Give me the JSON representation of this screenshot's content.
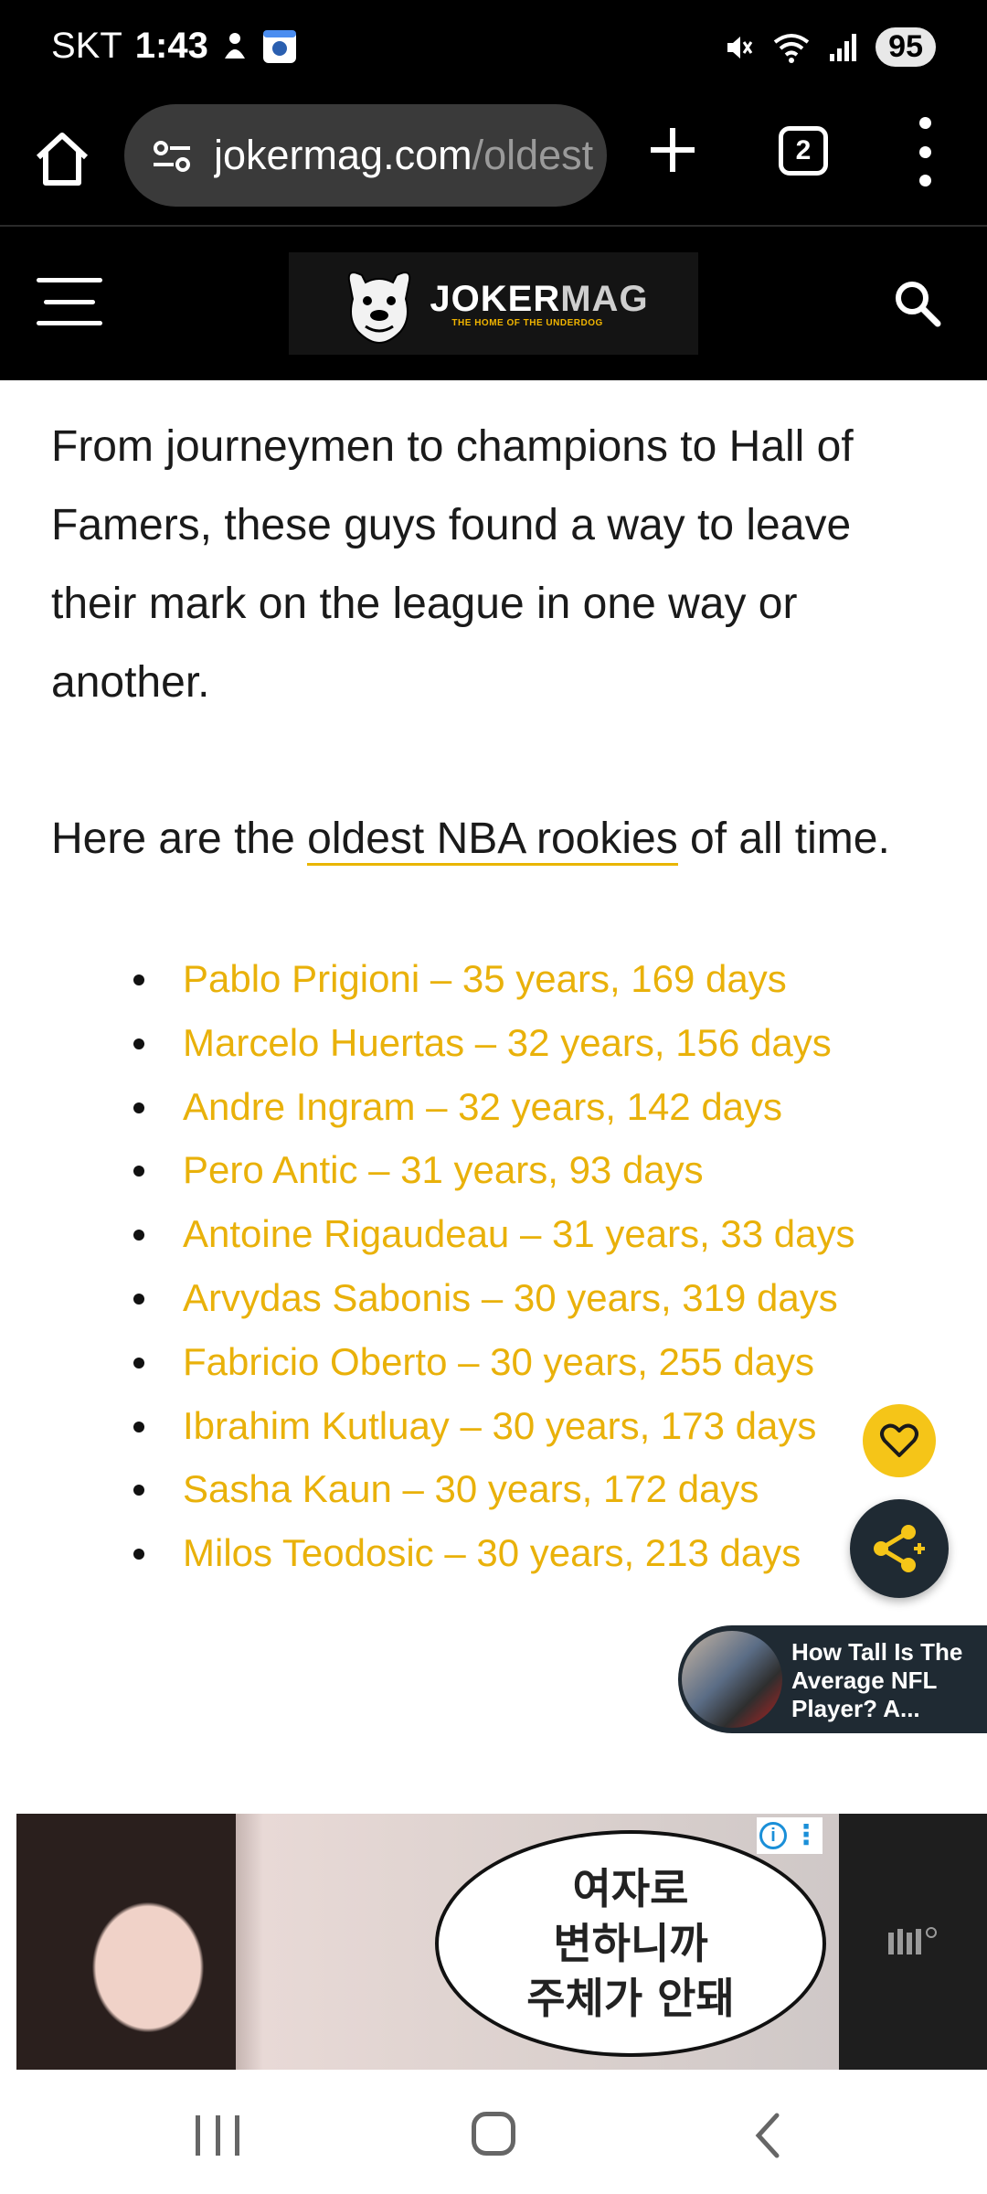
{
  "status_bar": {
    "carrier": "SKT",
    "time": "1:43",
    "battery": "95"
  },
  "browser": {
    "url_host": "jokermag.com",
    "url_path": "/oldest",
    "tab_count": "2"
  },
  "site": {
    "logo_main_joker": "JOKER",
    "logo_main_mag": "MAG",
    "logo_tagline": "THE HOME OF THE UNDERDOG"
  },
  "article": {
    "intro": "From journeymen to champions to Hall of Famers, these guys found a way to leave their mark on the league in one way or another.",
    "lead_before": "Here are the ",
    "lead_link": "oldest NBA rookies",
    "lead_after": " of all time.",
    "rookies": [
      "Pablo Prigioni – 35 years, 169 days",
      "Marcelo Huertas – 32 years, 156 days",
      "Andre Ingram – 32 years, 142 days",
      "Pero Antic – 31 years, 93 days",
      "Antoine Rigaudeau – 31 years, 33 days",
      "Arvydas Sabonis – 30 years, 319 days",
      "Fabricio Oberto – 30 years, 255 days",
      "Ibrahim Kutluay – 30 years, 173 days",
      "Sasha Kaun – 30 years, 172 days",
      "Milos Teodosic – 30 years, 213 days"
    ]
  },
  "related": {
    "title": "How Tall Is The Average NFL Player? A..."
  },
  "ad": {
    "speech_lines": [
      "여자로",
      "변하니까",
      "주체가 안돼"
    ]
  },
  "colors": {
    "link_gold": "#e9b10a",
    "fab_yellow": "#f5c518",
    "fab_dark": "#1f2a33"
  }
}
